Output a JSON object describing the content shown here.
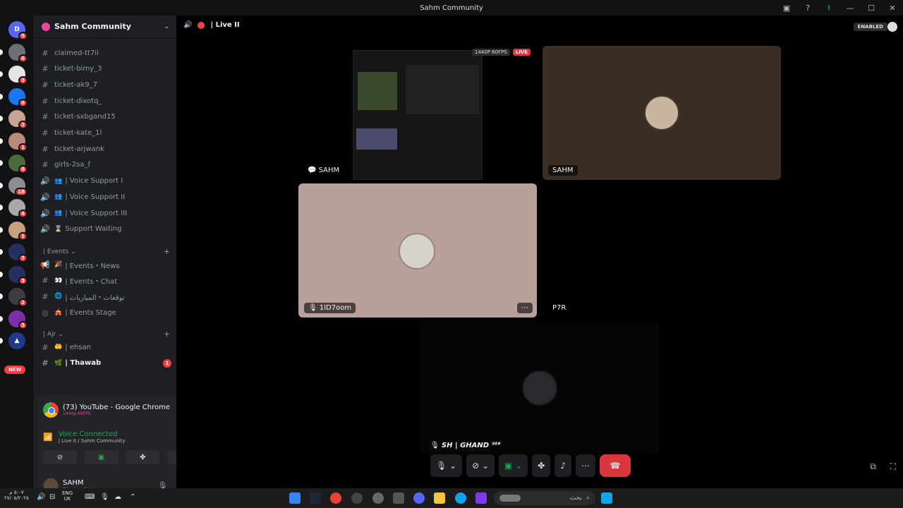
{
  "window": {
    "title": "Sahm Community"
  },
  "rail": {
    "servers": [
      {
        "label": "D",
        "color": "#5865f2",
        "badge": "9"
      },
      {
        "label": "",
        "color": "#6d6f78",
        "badge": "6"
      },
      {
        "label": "",
        "color": "#e6e6e6",
        "badge": "3"
      },
      {
        "label": "",
        "color": "#1877f2",
        "badge": "6"
      },
      {
        "label": "",
        "color": "#c8a394",
        "badge": "2"
      },
      {
        "label": "",
        "color": "#b88a7a",
        "badge": "1"
      },
      {
        "label": "",
        "color": "#4a6b3a",
        "badge": "8"
      },
      {
        "label": "",
        "color": "#8a8d93",
        "badge": "18"
      },
      {
        "label": "",
        "color": "#a7a9ad",
        "badge": "4"
      },
      {
        "label": "",
        "color": "#c7a17f",
        "badge": "1"
      },
      {
        "label": "",
        "color": "#26305e",
        "badge": "7"
      },
      {
        "label": "",
        "color": "#26305e",
        "badge": "3"
      },
      {
        "label": "",
        "color": "#3b3d42",
        "badge": "2"
      },
      {
        "label": "",
        "color": "#7b2fa8",
        "badge": "3"
      },
      {
        "label": "▲",
        "color": "#1e3a8a",
        "badge": ""
      }
    ],
    "new_label": "NEW"
  },
  "sidebar": {
    "guild": "Sahm Community",
    "channels": [
      {
        "icon": "#",
        "emoji": "",
        "name": "claimed-tt7ii",
        "bold": false
      },
      {
        "icon": "#",
        "emoji": "",
        "name": "ticket-bimy_3",
        "bold": false
      },
      {
        "icon": "#",
        "emoji": "",
        "name": "ticket-ak9_7",
        "bold": false
      },
      {
        "icon": "#",
        "emoji": "",
        "name": "ticket-dixotq_",
        "bold": false
      },
      {
        "icon": "#",
        "emoji": "",
        "name": "ticket-sxbgand15",
        "bold": false
      },
      {
        "icon": "#",
        "emoji": "",
        "name": "ticket-kate_1l",
        "bold": false
      },
      {
        "icon": "#",
        "emoji": "",
        "name": "ticket-arjwank",
        "bold": false
      },
      {
        "icon": "#",
        "emoji": "",
        "name": "girls-2sa_f",
        "bold": false
      },
      {
        "icon": "🔊",
        "emoji": "👥",
        "name": "| Voice Support I",
        "bold": false
      },
      {
        "icon": "🔊",
        "emoji": "👥",
        "name": "| Voice Support II",
        "bold": false
      },
      {
        "icon": "🔊",
        "emoji": "👥",
        "name": "| Voice Support III",
        "bold": false
      },
      {
        "icon": "🔊",
        "emoji": "⌛",
        "name": "Support Waiting",
        "bold": false
      }
    ],
    "events_category": "| Events",
    "events": [
      {
        "icon": "📢",
        "emoji": "🎉",
        "name": "| Events・News",
        "bold": false
      },
      {
        "icon": "#",
        "emoji": "👀",
        "name": "| Events・Chat",
        "bold": false
      },
      {
        "icon": "#",
        "emoji": "🌐",
        "name": "| توقعات・المباريات",
        "bold": false
      },
      {
        "icon": "◎",
        "emoji": "🎪",
        "name": "| Events Stage",
        "bold": false
      }
    ],
    "ajr_category": "| Ajr",
    "ajr": [
      {
        "icon": "#",
        "emoji": "🤲",
        "name": "| ehsan",
        "bold": false
      },
      {
        "icon": "#",
        "emoji": "🌿",
        "name": "| Thawab",
        "bold": true,
        "badge": "1"
      }
    ]
  },
  "panel": {
    "stream_title": "(73) YouTube - Google Chrome",
    "stream_quality": "1440p 60FPS",
    "voice_status": "Voice Connected",
    "voice_channel": "| Live II / Sahm Community",
    "username": "SAHM",
    "user_status": "Sharing their screen"
  },
  "stage": {
    "channel": "| Live II",
    "enabled": "ENABLED",
    "tiles": [
      {
        "label": "SAHM",
        "badge": "1440P 60FPS",
        "live": "LIVE"
      },
      {
        "label": "SAHM"
      },
      {
        "label": "1lD7oom"
      },
      {
        "label": "P7R"
      },
      {
        "label": "SH | GHAND ³⁶⁹"
      }
    ]
  },
  "taskbar": {
    "time": "٥:٠٧ م",
    "date": "٢٧/٠٥/٢٠٢٥",
    "lang": "ENG",
    "region": "UK",
    "search_placeholder": "بحث"
  }
}
